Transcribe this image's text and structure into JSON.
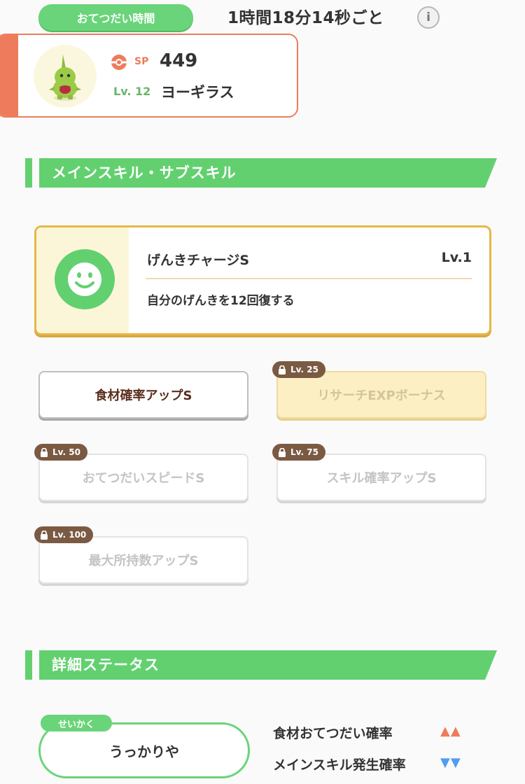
{
  "help_time": {
    "label": "おてつだい時間",
    "value": "1時間18分14秒ごと"
  },
  "info_icon": "info-icon",
  "pokemon": {
    "sp_label": "SP",
    "sp_value": "449",
    "level_label": "Lv. 12",
    "name": "ヨーギラス"
  },
  "sections": {
    "skills_title": "メインスキル・サブスキル",
    "details_title": "詳細ステータス"
  },
  "main_skill": {
    "name": "げんきチャージS",
    "level": "Lv.1",
    "description": "自分のげんきを12回復する"
  },
  "sub_skills": [
    {
      "label": "食材確率アップS",
      "lock": ""
    },
    {
      "label": "リサーチEXPボーナス",
      "lock": "Lv. 25"
    },
    {
      "label": "おてつだいスピードS",
      "lock": "Lv. 50"
    },
    {
      "label": "スキル確率アップS",
      "lock": "Lv. 75"
    },
    {
      "label": "最大所持数アップS",
      "lock": "Lv. 100"
    }
  ],
  "nature": {
    "tag": "せいかく",
    "value": "うっかりや",
    "effects": [
      {
        "label": "食材おてつだい確率",
        "arrows": "▲▲",
        "color": "#ee7c5c"
      },
      {
        "label": "メインスキル発生確率",
        "arrows": "▼▼",
        "color": "#4f9ef0"
      }
    ]
  },
  "colors": {
    "accent_green": "#63d070",
    "accent_orange": "#ee7c5c",
    "gold": "#e6b84a"
  }
}
